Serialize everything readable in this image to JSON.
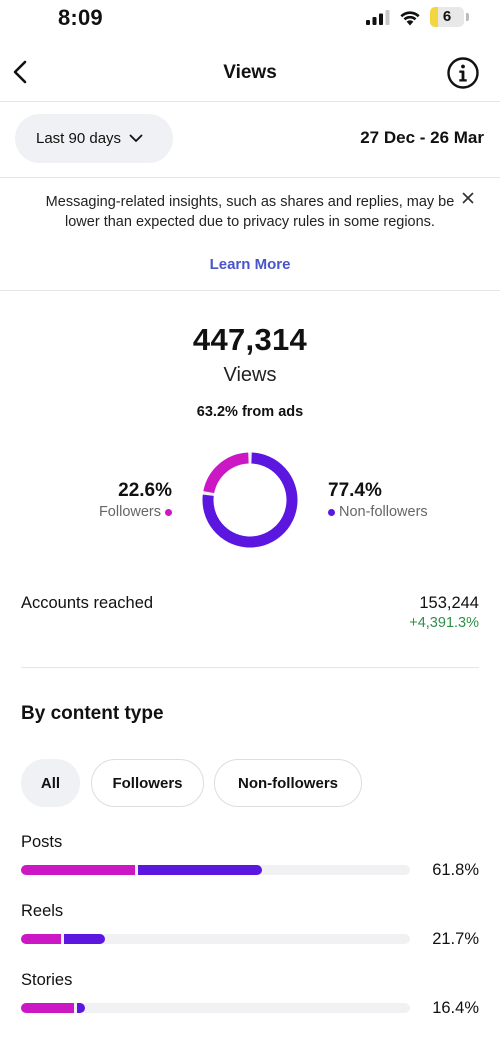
{
  "status_bar": {
    "time": "8:09",
    "battery_level": "6",
    "icons": [
      "cellular-signal-icon",
      "wifi-icon",
      "battery-icon"
    ]
  },
  "nav": {
    "title": "Views",
    "back_icon": "chevron-left-icon",
    "info_icon": "info-icon"
  },
  "date_filter": {
    "selected": "Last 90 days",
    "range": "27 Dec - 26 Mar"
  },
  "banner": {
    "message": "Messaging-related insights, such as shares and replies, may be lower than expected due to privacy rules in some regions.",
    "link": "Learn More"
  },
  "summary": {
    "views": "447,314",
    "views_label": "Views",
    "from_ads": "63.2% from ads",
    "followers_pct": "22.6%",
    "followers_label": "Followers",
    "non_followers_pct": "77.4%",
    "non_followers_label": "Non-followers",
    "donut_fractions": {
      "followers": 0.226,
      "non_followers": 0.774
    }
  },
  "accounts_reached": {
    "label": "Accounts reached",
    "value": "153,244",
    "change": "+4,391.3%"
  },
  "by_content_type": {
    "title": "By content type",
    "filters": [
      "All",
      "Followers",
      "Non-followers"
    ],
    "active_filter": "All",
    "rows": [
      {
        "label": "Posts",
        "pct": "61.8%",
        "followers_fraction": 0.294,
        "non_followers_fraction": 0.325
      },
      {
        "label": "Reels",
        "pct": "21.7%",
        "followers_fraction": 0.103,
        "non_followers_fraction": 0.114
      },
      {
        "label": "Stories",
        "pct": "16.4%",
        "followers_fraction": 0.135,
        "non_followers_fraction": 0.029
      }
    ]
  },
  "colors": {
    "followers": "#cc18c4",
    "non_followers": "#5b16e0",
    "link": "#4a55c9",
    "positive_change": "#2f8f4a"
  }
}
